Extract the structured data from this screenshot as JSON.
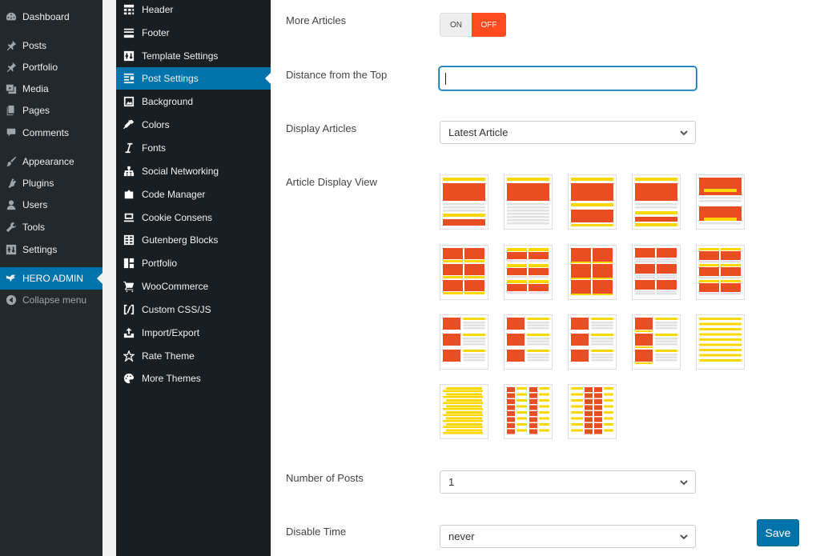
{
  "admin_menu": {
    "items": [
      {
        "label": "Dashboard",
        "icon": "dashboard-icon"
      },
      {
        "label": "Posts",
        "icon": "pin-icon"
      },
      {
        "label": "Portfolio",
        "icon": "pin-icon"
      },
      {
        "label": "Media",
        "icon": "media-icon"
      },
      {
        "label": "Pages",
        "icon": "pages-icon"
      },
      {
        "label": "Comments",
        "icon": "comment-icon"
      },
      {
        "label": "Appearance",
        "icon": "brush-icon"
      },
      {
        "label": "Plugins",
        "icon": "plugin-icon"
      },
      {
        "label": "Users",
        "icon": "user-icon"
      },
      {
        "label": "Tools",
        "icon": "wrench-icon"
      },
      {
        "label": "Settings",
        "icon": "settings-icon"
      },
      {
        "label": "HERO ADMIN",
        "icon": "bird-icon"
      },
      {
        "label": "Collapse menu",
        "icon": "collapse-icon"
      }
    ]
  },
  "sub_menu": {
    "items": [
      {
        "label": "Header",
        "icon": "header-icon"
      },
      {
        "label": "Footer",
        "icon": "footer-icon"
      },
      {
        "label": "Template Settings",
        "icon": "template-icon"
      },
      {
        "label": "Post Settings",
        "icon": "post-settings-icon"
      },
      {
        "label": "Background",
        "icon": "image-icon"
      },
      {
        "label": "Colors",
        "icon": "eyedropper-icon"
      },
      {
        "label": "Fonts",
        "icon": "italic-icon"
      },
      {
        "label": "Social Networking",
        "icon": "network-icon"
      },
      {
        "label": "Code Manager",
        "icon": "code-icon"
      },
      {
        "label": "Cookie Consens",
        "icon": "cookie-icon"
      },
      {
        "label": "Gutenberg Blocks",
        "icon": "table-icon"
      },
      {
        "label": "Portfolio",
        "icon": "portfolio-icon"
      },
      {
        "label": "WooCommerce",
        "icon": "cart-icon"
      },
      {
        "label": "Custom CSS/JS",
        "icon": "css-icon"
      },
      {
        "label": "Import/Export",
        "icon": "upload-icon"
      },
      {
        "label": "Rate Theme",
        "icon": "star-icon"
      },
      {
        "label": "More Themes",
        "icon": "palette-icon"
      }
    ]
  },
  "settings": {
    "more_articles": {
      "label": "More Articles",
      "on": "ON",
      "off": "OFF",
      "state": "off"
    },
    "distance_top": {
      "label": "Distance from the Top",
      "value": ""
    },
    "display_articles": {
      "label": "Display Articles",
      "value": "Latest Article"
    },
    "article_view": {
      "label": "Article Display View",
      "options_count": 18,
      "selected": 1
    },
    "number_posts": {
      "label": "Number of Posts",
      "value": "1"
    },
    "disable_time": {
      "label": "Disable Time",
      "value": "never"
    }
  },
  "save_label": "Save",
  "colors": {
    "accent": "#0073aa",
    "off": "#ff4b1f",
    "tile_orange": "#e94e22",
    "tile_yellow": "#ffd700",
    "tile_grey": "#e2e2e2"
  }
}
